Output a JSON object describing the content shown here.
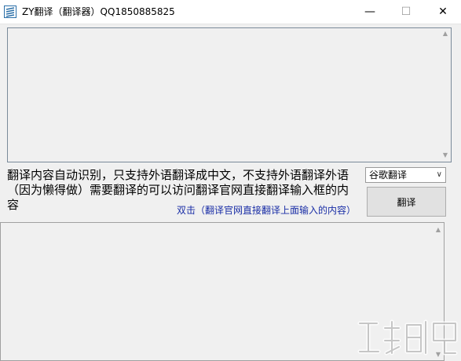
{
  "window": {
    "title": "ZY翻译（翻译器）QQ1850885825",
    "icon": "app-logo-icon",
    "controls": {
      "minimize": "—",
      "maximize": "☐",
      "close": "✕"
    }
  },
  "source_input": {
    "value": "",
    "placeholder": ""
  },
  "info": {
    "text": "翻译内容自动识别，只支持外语翻译成中文，不支持外语翻译外语（因为懒得做）需要翻译的可以访问翻译官网直接翻译输入框的内容",
    "link_text": "双击（翻译官网直接翻译上面输入的内容）",
    "link_color": "#1a2ea6"
  },
  "engine_select": {
    "selected": "谷歌翻译"
  },
  "translate_button": {
    "label": "翻译"
  },
  "result_output": {
    "value": ""
  },
  "watermark": {
    "icon": "watermark-logo"
  }
}
